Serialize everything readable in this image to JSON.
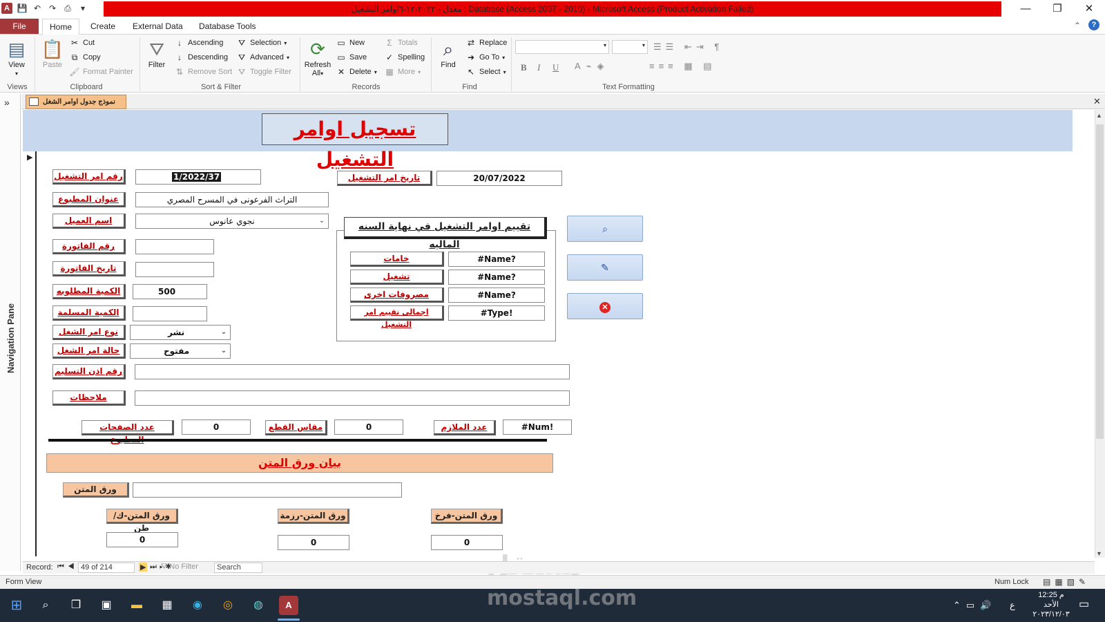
{
  "titlebar": {
    "title": "معدل - ٢٠٢٢-١٢-٦اوامر التشغيل : Database (Access 2007 - 2010)  -  Microsoft Access (Product Activation Failed)",
    "minimize": "—",
    "restore": "❐",
    "close": "✕"
  },
  "tabs": {
    "file": "File",
    "home": "Home",
    "create": "Create",
    "external": "External Data",
    "dbtools": "Database Tools"
  },
  "ribbon": {
    "views": {
      "view": "View",
      "group": "Views"
    },
    "clipboard": {
      "paste": "Paste",
      "cut": "Cut",
      "copy": "Copy",
      "format_painter": "Format Painter",
      "group": "Clipboard"
    },
    "sort": {
      "filter": "Filter",
      "ascending": "Ascending",
      "descending": "Descending",
      "remove_sort": "Remove Sort",
      "selection": "Selection",
      "advanced": "Advanced",
      "toggle_filter": "Toggle Filter",
      "group": "Sort & Filter"
    },
    "records": {
      "refresh": "Refresh",
      "refresh2": "All",
      "new": "New",
      "save": "Save",
      "delete": "Delete",
      "totals": "Totals",
      "spelling": "Spelling",
      "more": "More",
      "group": "Records"
    },
    "find": {
      "find": "Find",
      "replace": "Replace",
      "goto": "Go To",
      "select": "Select",
      "group": "Find"
    },
    "text": {
      "group": "Text Formatting",
      "bold": "B",
      "italic": "I",
      "underline": "U"
    }
  },
  "nav": {
    "label": "Navigation Pane",
    "toggle": "»"
  },
  "doc": {
    "tab_title": "نموذج جدول اوامر الشغل",
    "close": "✕"
  },
  "form": {
    "title": "تسجيل اوامر التشغيل",
    "fields": {
      "order_no": {
        "label": "رقم امر التشغيل",
        "value": "1/2022/37"
      },
      "order_date": {
        "label": "تاريخ امر التشغيل",
        "value": "20/07/2022"
      },
      "print_title": {
        "label": "عنوان المطبوع",
        "value": "التراث الفرعونى في المسرح المصري"
      },
      "client": {
        "label": "اسم العميل",
        "value": "نجوي عانوس"
      },
      "invoice_no": {
        "label": "رقم الفاتورة",
        "value": ""
      },
      "invoice_date": {
        "label": "تاريخ الفاتورة",
        "value": ""
      },
      "qty_required": {
        "label": "الكمية المطلوبه",
        "value": "500"
      },
      "qty_delivered": {
        "label": "الكمية المسلمة",
        "value": ""
      },
      "order_type": {
        "label": "نوع امر الشغل",
        "value": "نشر"
      },
      "order_status": {
        "label": "حالة امر الشغل",
        "value": "مفتوح"
      },
      "delivery_no": {
        "label": "رقم اذن التسليم",
        "value": ""
      },
      "notes": {
        "label": "ملاحظات",
        "value": ""
      },
      "pages": {
        "label": "عدد الصفحات المطبوع",
        "value": "0"
      },
      "cut_size": {
        "label": "مقاس القطع",
        "value": "0"
      },
      "sheets": {
        "label": "عدد الملازم",
        "value": "#Num!"
      }
    },
    "evaluation": {
      "title": "تقييم اوامر التشغيل في نهاية السنه الماليه",
      "rows": [
        {
          "label": "خامات",
          "value": "#Name?"
        },
        {
          "label": "تشغيل",
          "value": "#Name?"
        },
        {
          "label": "مصروفات اخرى",
          "value": "#Name?"
        },
        {
          "label": "اجمالى تقييم امر التشغيل",
          "value": "#Type!"
        }
      ]
    },
    "buttons": {
      "search": "⌕",
      "edit": "✎",
      "close": "✕"
    },
    "paper": {
      "header": "بيان ورق المتن",
      "paper_label": "ورق المتن",
      "paper_value": "",
      "kg": {
        "label": "ورق المتن-ك/طن",
        "value": "0"
      },
      "ream": {
        "label": "ورق المتن-رزمة",
        "value": "0"
      },
      "sheet": {
        "label": "ورق المتن-فرخ",
        "value": "0"
      }
    }
  },
  "recnav": {
    "record_label": "Record:",
    "position": "49 of 214",
    "no_filter": "No Filter",
    "search": "Search"
  },
  "status": {
    "left": "Form View",
    "numlock": "Num Lock"
  },
  "taskbar": {
    "time": "12:25 م",
    "day": "الأحد",
    "date": "٢٠٢٣/١٢/٠٣",
    "lang": "ع"
  },
  "watermark": {
    "arabic": "مستقل",
    "latin": "mostaql.com"
  }
}
